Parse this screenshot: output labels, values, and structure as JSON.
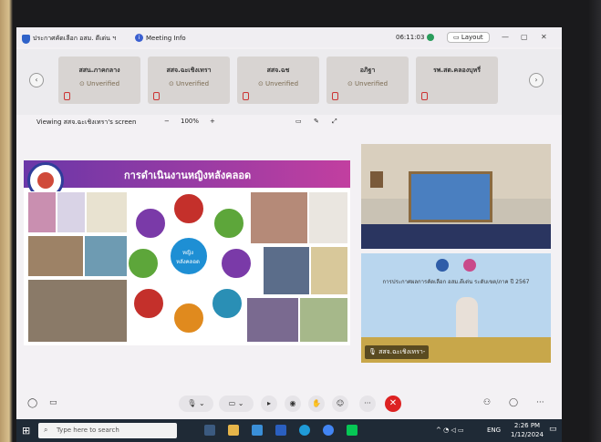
{
  "window": {
    "title": "ประกาศคัดเลือก อสม. ดีเด่น ฯ",
    "meeting_info": "Meeting Info",
    "timer": "06:11:03",
    "layout_label": "Layout"
  },
  "participants": [
    {
      "name": "สสน.ภาคกลาง",
      "status": "Unverified"
    },
    {
      "name": "สสจ.ฉะเชิงเทรา",
      "status": "Unverified"
    },
    {
      "name": "สสจ.ฉช",
      "status": "Unverified"
    },
    {
      "name": "อภิฐา",
      "status": "Unverified"
    },
    {
      "name": "รพ.สต.คลองบุหรี่",
      "status": ""
    }
  ],
  "viewing": {
    "label": "Viewing สสจ.ฉะเชิงเทรา's screen",
    "zoom_minus": "−",
    "zoom": "100%",
    "zoom_plus": "+"
  },
  "slide": {
    "title": "การดำเนินงานหญิงหลังคลอด",
    "center": "หญิง\nหลังคลอด"
  },
  "video2": {
    "banner": "การประกาศผลการคัดเลือก อสม.ดีเด่น ระดับเขต/ภาค ปี 2567",
    "caption": "สสจ.ฉะเชิงเทรา-"
  },
  "taskbar": {
    "search_placeholder": "Type here to search",
    "lang": "ENG",
    "time": "2:26 PM",
    "date": "1/12/2024"
  },
  "colors": {
    "accent": "#2f62c9",
    "end_call": "#d22222",
    "slide_title": "#6a37a8"
  }
}
